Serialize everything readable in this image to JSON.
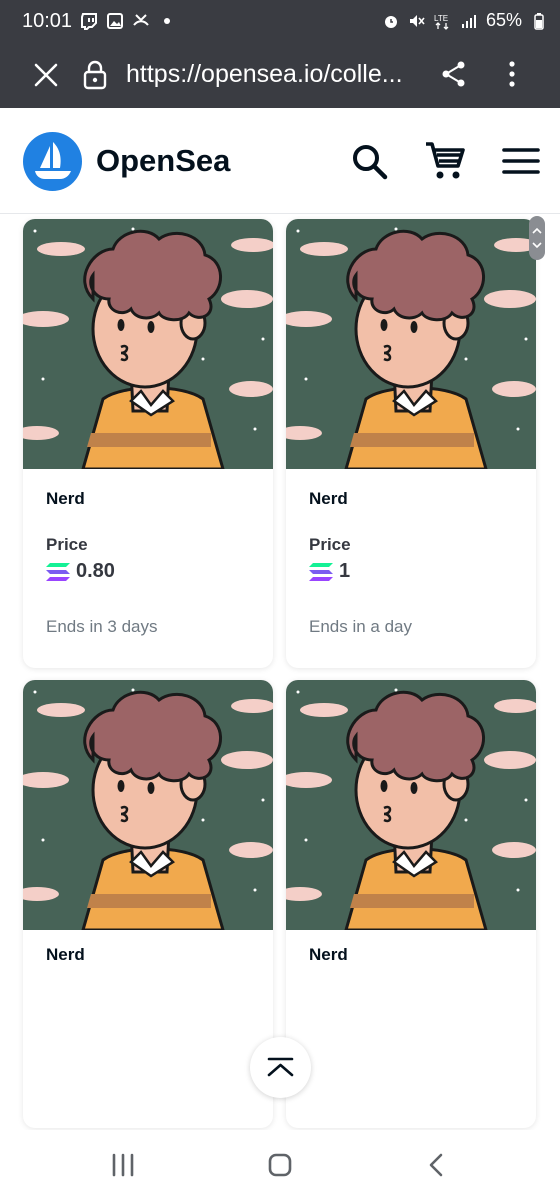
{
  "status_bar": {
    "time": "10:01",
    "battery": "65%",
    "network": "LTE",
    "notification_icons": [
      "twitch-icon",
      "gallery-icon",
      "missed-call-icon",
      "dot-icon"
    ],
    "system_icons": [
      "alarm-icon",
      "mute-icon",
      "lte-icon",
      "signal-icon",
      "battery-icon"
    ]
  },
  "browser": {
    "url": "https://opensea.io/colle..."
  },
  "header": {
    "brand": "OpenSea",
    "brand_color": "#2081e2"
  },
  "cards": [
    {
      "name": "Nerd",
      "price_label": "Price",
      "price": "0.80",
      "ends": "Ends in 3 days",
      "currency_icon": "solana-icon"
    },
    {
      "name": "Nerd",
      "price_label": "Price",
      "price": "1",
      "ends": "Ends in a day",
      "currency_icon": "solana-icon"
    },
    {
      "name": "Nerd"
    },
    {
      "name": "Nerd"
    }
  ],
  "colors": {
    "chrome_bg": "#3a3c42",
    "art_bg": "#476357",
    "hair": "#9c6466",
    "skin": "#f2bfa8",
    "sweater": "#f1a94d",
    "sweater_stripe": "#c0824a",
    "cloud": "#f4cfc8"
  }
}
